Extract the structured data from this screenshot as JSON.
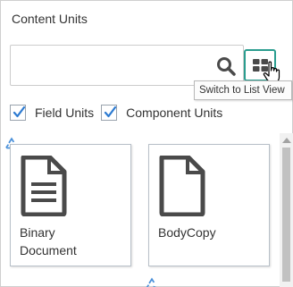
{
  "panel": {
    "title": "Content Units"
  },
  "search": {
    "value": "",
    "placeholder": "",
    "icon": "search-icon"
  },
  "view_toggle": {
    "icon": "grid-view-icon",
    "tooltip": "Switch to List View"
  },
  "filters": [
    {
      "label": "Field Units",
      "checked": true
    },
    {
      "label": "Component Units",
      "checked": true
    }
  ],
  "items": [
    {
      "label": "Binary\nDocument",
      "icon": "text-document-icon"
    },
    {
      "label": "BodyCopy",
      "icon": "blank-document-icon"
    }
  ],
  "colors": {
    "accent": "#2a9d8f",
    "checkbox": "#2d7bd1",
    "icon_gray": "#4a4a4a",
    "recycle": "#4a90d9"
  }
}
